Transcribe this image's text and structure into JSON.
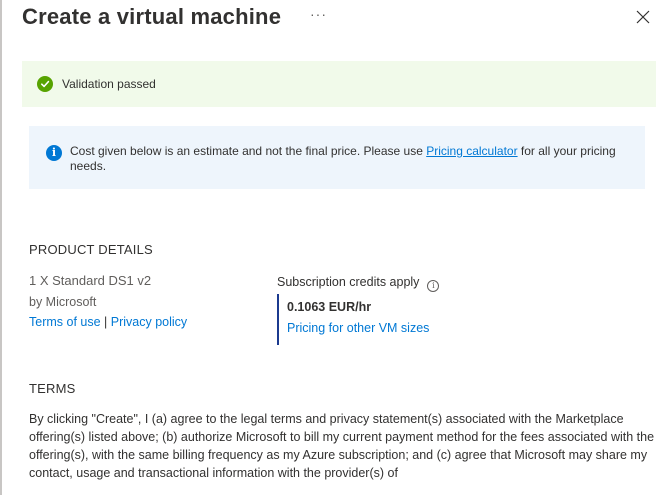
{
  "header": {
    "title": "Create a virtual machine",
    "more_label": "···"
  },
  "validation": {
    "message": "Validation passed",
    "color": "#57a300"
  },
  "info": {
    "text_before": "Cost given below is an estimate and not the final price. Please use ",
    "link": "Pricing calculator",
    "text_after": " for all your pricing needs.",
    "icon_label": "i"
  },
  "product": {
    "heading": "PRODUCT DETAILS",
    "name": "1 X Standard DS1 v2",
    "publisher": "by Microsoft",
    "terms_link": "Terms of use",
    "separator": " | ",
    "privacy_link": "Privacy policy",
    "credits_label": "Subscription credits apply",
    "credits_info_icon": "i",
    "price": "0.1063 EUR/hr",
    "other_sizes_link": "Pricing for other VM sizes"
  },
  "terms": {
    "heading": "TERMS",
    "text": "By clicking \"Create\", I (a) agree to the legal terms and privacy statement(s) associated with the Marketplace offering(s) listed above; (b) authorize Microsoft to bill my current payment method for the fees associated with the offering(s), with the same billing frequency as my Azure subscription; and (c) agree that Microsoft may share my contact, usage and transactional information with the provider(s) of"
  },
  "colors": {
    "accent": "#0078d4",
    "success_bg": "#f1faea",
    "info_bg": "#eef5fc"
  }
}
